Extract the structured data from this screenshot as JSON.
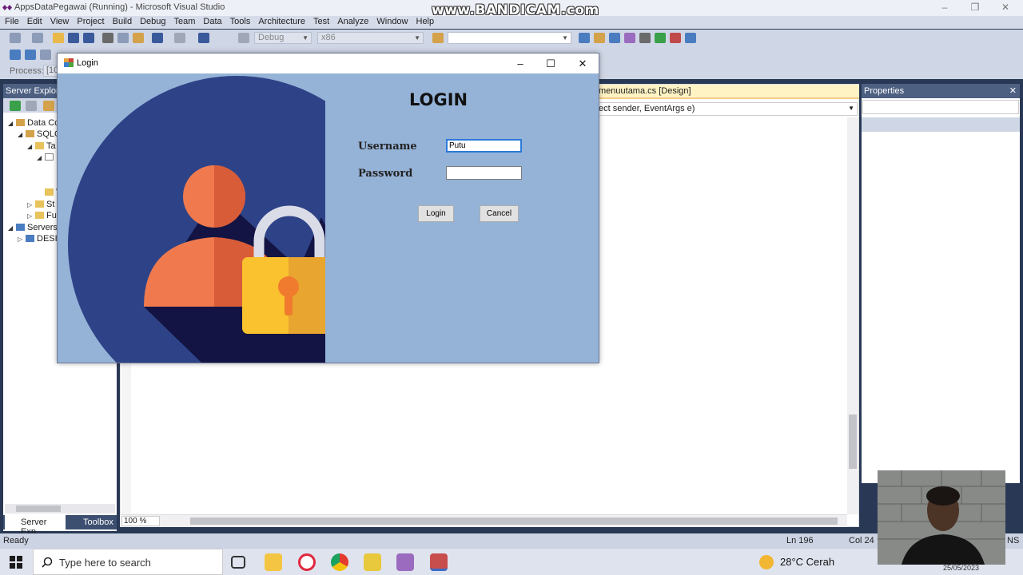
{
  "vs": {
    "title": "AppsDataPegawai (Running) - Microsoft Visual Studio",
    "menu": [
      "File",
      "Edit",
      "View",
      "Project",
      "Build",
      "Debug",
      "Team",
      "Data",
      "Tools",
      "Architecture",
      "Test",
      "Analyze",
      "Window",
      "Help"
    ],
    "toolbar": {
      "config": "Debug",
      "platform": "x86"
    },
    "process_label": "Process:",
    "process_value": "[10",
    "server_explorer": {
      "title": "Server Explorer",
      "tree": [
        "Data Co",
        "SQLC",
        "Ta",
        "Vi",
        "St",
        "Fu",
        "Servers",
        "DESI"
      ]
    },
    "bottom_tabs": {
      "server": "Server Exp...",
      "toolbox": "Toolbox"
    },
    "designer_tab": "menuutama.cs [Design]",
    "designer_combo": "ect sender, EventArgs e)",
    "zoom": "100 %",
    "properties_title": "Properties",
    "status": {
      "ready": "Ready",
      "line": "Ln 196",
      "col": "Col 24",
      "ins": "NS"
    }
  },
  "watermark": "www.BANDICAM.com",
  "login": {
    "window_title": "Login",
    "heading": "LOGIN",
    "username_label": "Username",
    "username_value": "Putu",
    "password_label": "Password",
    "password_value": "",
    "login_button": "Login",
    "cancel_button": "Cancel"
  },
  "taskbar": {
    "search_placeholder": "Type here to search",
    "weather": "28°C  Cerah",
    "date": "25/05/2023"
  },
  "colors": {
    "dialog_bg": "#95b3d7",
    "art_circle": "#2e4387",
    "art_shadow": "#131443",
    "person": "#f07a4e",
    "lock": "#f9c22e"
  }
}
